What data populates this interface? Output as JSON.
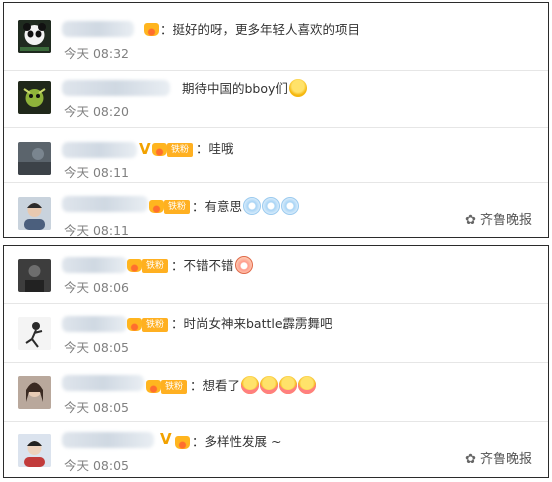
{
  "panels": [
    {
      "comments": [
        {
          "text": "：挺好的呀，更多年轻人喜欢的项目",
          "time": "今天 08:32",
          "avatar_icon": "panda-avatar",
          "avatar_color": "#3a3a3a"
        },
        {
          "text": "期待中国的bboy们",
          "time": "今天 08:20",
          "avatar_icon": "cartoon-avatar",
          "avatar_color": "#2f3b22"
        },
        {
          "text": "：哇哦",
          "time": "今天 08:11",
          "avatar_icon": "photo-avatar",
          "avatar_color": "#56606a"
        },
        {
          "text": "：有意思",
          "time": "今天 08:11",
          "avatar_icon": "person-avatar",
          "avatar_color": "#6b7c8e"
        }
      ],
      "watermark": "齐鲁晚报"
    },
    {
      "comments": [
        {
          "text": "：不错不错",
          "time": "今天 08:06",
          "avatar_icon": "photo-avatar",
          "avatar_color": "#444444"
        },
        {
          "text": "：时尚女神来battle霹雳舞吧",
          "time": "今天 08:05",
          "avatar_icon": "sketch-avatar",
          "avatar_color": "#f0f0f0"
        },
        {
          "text": "：想看了",
          "time": "今天 08:05",
          "avatar_icon": "person-avatar",
          "avatar_color": "#8a7a70"
        },
        {
          "text": "：多样性发展 ~",
          "time": "今天 08:05",
          "avatar_icon": "person-avatar",
          "avatar_color": "#4a5a75"
        }
      ],
      "watermark": "齐鲁晚报"
    }
  ],
  "badge": {
    "fan_label": "铁粉",
    "verified_mark": "V"
  },
  "colors": {
    "time_text": "#808080",
    "fan_badge": "#ffb021",
    "verified": "#f2a200",
    "divider": "#e6e6e6"
  }
}
